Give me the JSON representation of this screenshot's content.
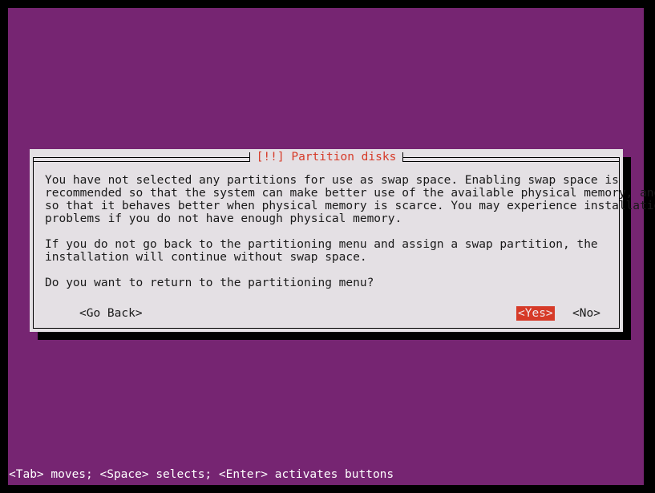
{
  "screen": {
    "backdrop_color": "#762572",
    "frame_color": "#000000"
  },
  "dialog": {
    "title": "[!!] Partition disks",
    "title_color": "#d63a28",
    "background_color": "#e4e0e4",
    "paragraphs": [
      "You have not selected any partitions for use as swap space. Enabling swap space is\nrecommended so that the system can make better use of the available physical memory, and\nso that it behaves better when physical memory is scarce. You may experience installation\nproblems if you do not have enough physical memory.",
      "If you do not go back to the partitioning menu and assign a swap partition, the\ninstallation will continue without swap space."
    ],
    "question": "Do you want to return to the partitioning menu?",
    "buttons": {
      "go_back": "<Go Back>",
      "yes": "<Yes>",
      "no": "<No>",
      "selected": "yes",
      "highlight_color": "#d63a28",
      "highlight_text_color": "#f0e8ec"
    }
  },
  "statusbar": {
    "text": "<Tab> moves; <Space> selects; <Enter> activates buttons",
    "background_color": "#762572",
    "text_color": "#ffffff"
  }
}
